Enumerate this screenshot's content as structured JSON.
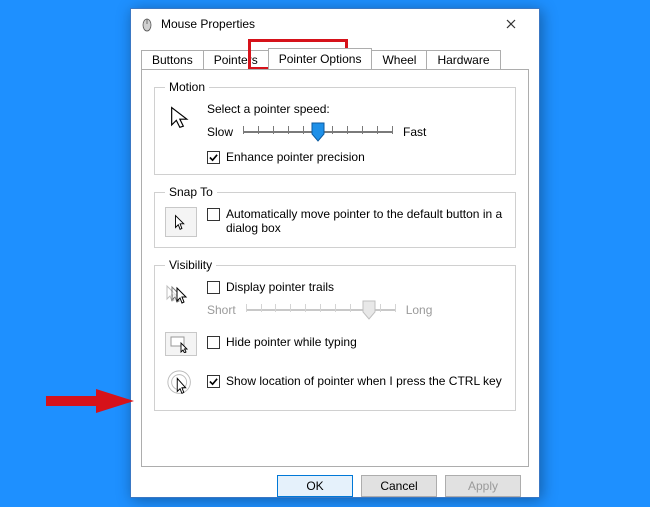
{
  "window": {
    "title": "Mouse Properties"
  },
  "tabs": {
    "t0": "Buttons",
    "t1": "Pointers",
    "t2": "Pointer Options",
    "t3": "Wheel",
    "t4": "Hardware"
  },
  "motion": {
    "legend": "Motion",
    "caption": "Select a pointer speed:",
    "slow": "Slow",
    "fast": "Fast",
    "enhance": "Enhance pointer precision",
    "enhance_checked": true,
    "speed_value": 6,
    "speed_ticks": 11
  },
  "snapto": {
    "legend": "Snap To",
    "auto": "Automatically move pointer to the default button in a dialog box",
    "auto_checked": false
  },
  "visibility": {
    "legend": "Visibility",
    "trails": "Display pointer trails",
    "trails_checked": false,
    "short": "Short",
    "long": "Long",
    "trail_value": 9,
    "trail_ticks": 11,
    "hide": "Hide pointer while typing",
    "hide_checked": false,
    "showloc": "Show location of pointer when I press the CTRL key",
    "showloc_checked": true
  },
  "buttons": {
    "ok": "OK",
    "cancel": "Cancel",
    "apply": "Apply"
  }
}
